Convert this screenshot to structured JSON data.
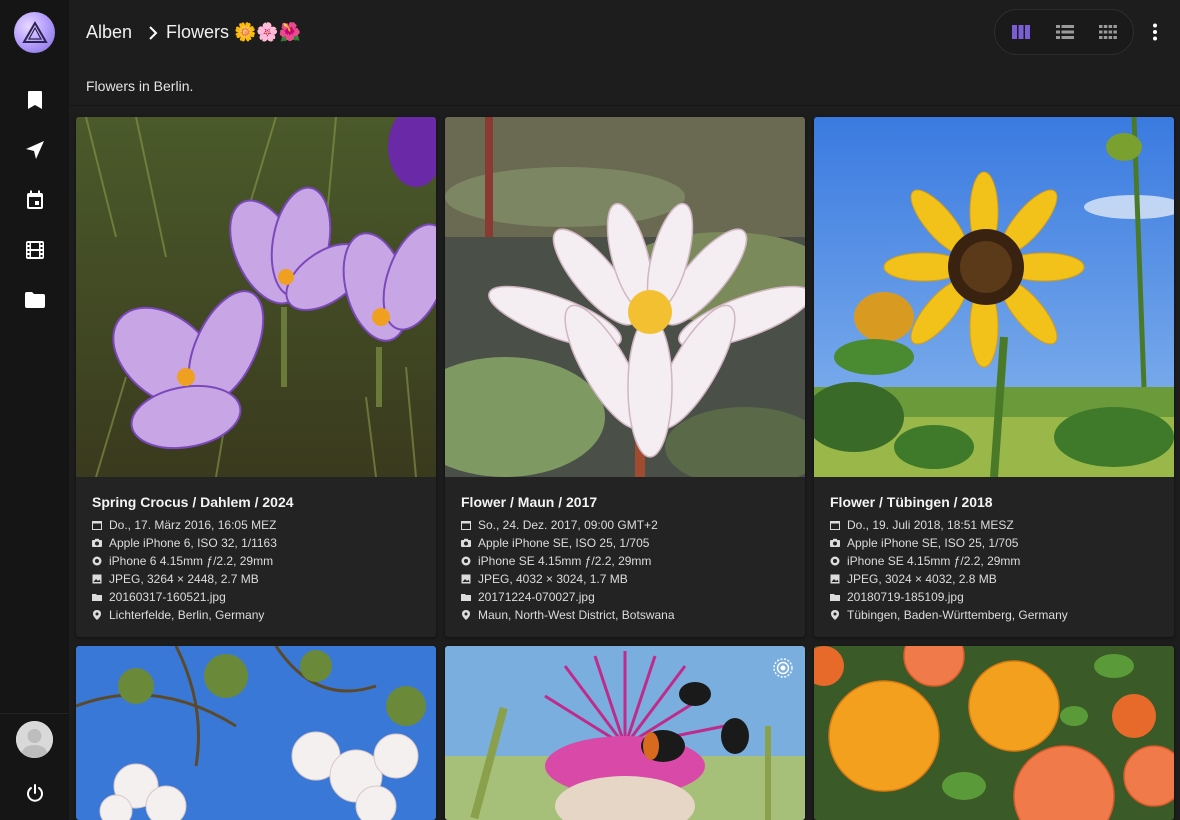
{
  "breadcrumb": {
    "root": "Alben",
    "current": "Flowers 🌼🌸🌺"
  },
  "album": {
    "description": "Flowers in Berlin."
  },
  "sidebar": {
    "items": [
      {
        "icon": "bookmark-icon"
      },
      {
        "icon": "navigation-arrow-icon"
      },
      {
        "icon": "calendar-icon"
      },
      {
        "icon": "film-icon"
      },
      {
        "icon": "folder-icon"
      }
    ],
    "bottom": {
      "avatar": "user-avatar",
      "power_icon": "power-icon"
    }
  },
  "view_modes": [
    "cards-view-icon",
    "list-view-icon",
    "mosaic-view-icon"
  ],
  "active_view": "cards-view-icon",
  "colors": {
    "background": "#1d1d1d",
    "sidebar": "#151515",
    "card": "#232323",
    "accent": "#7b5dd6"
  },
  "cards": [
    {
      "title": "Spring Crocus / Dahlem / 2024",
      "date": "Do., 17. März 2016, 16:05 MEZ",
      "camera": "Apple iPhone 6, ISO 32, 1/1163",
      "lens": "iPhone 6 4.15mm ƒ/2.2, 29mm",
      "file_info": "JPEG, 3264 × 2448, 2.7 MB",
      "filename": "20160317-160521.jpg",
      "location": "Lichterfelde, Berlin, Germany"
    },
    {
      "title": "Flower / Maun / 2017",
      "date": "So., 24. Dez. 2017, 09:00 GMT+2",
      "camera": "Apple iPhone SE, ISO 25, 1/705",
      "lens": "iPhone SE 4.15mm ƒ/2.2, 29mm",
      "file_info": "JPEG, 4032 × 3024, 1.7 MB",
      "filename": "20171224-070027.jpg",
      "location": "Maun, North-West District, Botswana"
    },
    {
      "title": "Flower / Tübingen / 2018",
      "date": "Do., 19. Juli 2018, 18:51 MESZ",
      "camera": "Apple iPhone SE, ISO 25, 1/705",
      "lens": "iPhone SE 4.15mm ƒ/2.2, 29mm",
      "file_info": "JPEG, 3024 × 4032, 2.8 MB",
      "filename": "20180719-185109.jpg",
      "location": "Tübingen, Baden-Württemberg, Germany"
    }
  ]
}
